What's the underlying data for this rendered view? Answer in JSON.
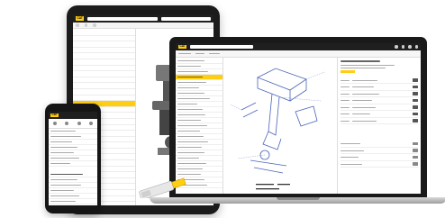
{
  "scene": {
    "devices": [
      "tablet",
      "laptop",
      "phone",
      "usb-drive"
    ]
  },
  "brand": {
    "logo_text": "CAT",
    "accent_color": "#ffcd11",
    "dark_color": "#1f1f1f"
  }
}
